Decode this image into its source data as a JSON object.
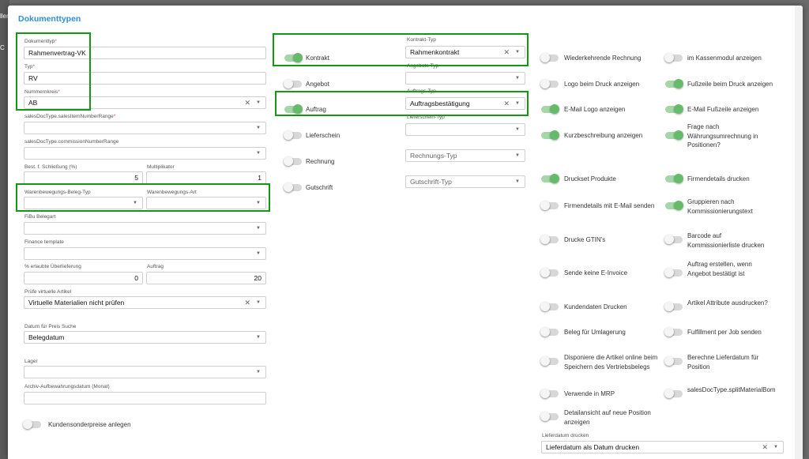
{
  "backdrop": {
    "frag_top": "llen",
    "frag_mid": "C"
  },
  "dialog": {
    "title": "Dokumenttypen"
  },
  "left": {
    "dokumenttyp": {
      "label": "Dokumenttyp",
      "value": "Rahmenvertrag-VK"
    },
    "typ": {
      "label": "Typ",
      "value": "RV"
    },
    "nummernkreis": {
      "label": "Nummernkreis",
      "value": "AB"
    },
    "item_number_range": {
      "label": "salesDocType.salesItemNumberRange",
      "value": ""
    },
    "commission_number_range": {
      "label": "salesDocType.commissionNumberRange",
      "value": ""
    },
    "schliessung": {
      "label": "Best. f. Schließung (%)",
      "value": "5"
    },
    "multiplikator": {
      "label": "Multiplikator",
      "value": "1"
    },
    "warenbewegungs_beleg_typ": {
      "label": "Warenbewegungs-Beleg-Typ",
      "value": ""
    },
    "warenbewegungs_art": {
      "label": "Warenbewegungs-Art",
      "value": ""
    },
    "fibu_belegart": {
      "label": "FiBu Belegart",
      "value": ""
    },
    "finance_template": {
      "label": "Finance template",
      "value": ""
    },
    "ueberlieferung": {
      "label": "% erlaubte Überlieferung",
      "value": "0"
    },
    "auftrag": {
      "label": "Auftrag",
      "value": "20"
    },
    "virtuelle_artikel": {
      "label": "Prüfe virtuelle Artikel",
      "value": "Virtuelle Materialien nicht prüfen"
    },
    "datum_preis_suche": {
      "label": "Datum für Preis Suche",
      "value": "Belegdatum"
    },
    "lager": {
      "label": "Lager",
      "value": ""
    },
    "archiv": {
      "label": "Archiv-Aufbewahrungsdatum (Monat)",
      "value": ""
    },
    "kundensonderpreise": {
      "label": "Kundensonderpreise anlegen",
      "on": false
    }
  },
  "middle": {
    "rows": [
      {
        "toggle": "Kontrakt",
        "on": true,
        "field_label": "Kontrakt-Typ",
        "value": "Rahmenkontrakt",
        "placeholder": ""
      },
      {
        "toggle": "Angebot",
        "on": false,
        "field_label": "Angebots-Typ",
        "value": "",
        "placeholder": ""
      },
      {
        "toggle": "Auftrag",
        "on": true,
        "field_label": "Auftrags-Typ",
        "value": "Auftragsbestätigung",
        "placeholder": ""
      },
      {
        "toggle": "Lieferschein",
        "on": false,
        "field_label": "Lieferschein-Typ",
        "value": "",
        "placeholder": ""
      },
      {
        "toggle": "Rechnung",
        "on": false,
        "field_label": "",
        "value": "",
        "placeholder": "Rechnungs-Typ"
      },
      {
        "toggle": "Gutschrift",
        "on": false,
        "field_label": "",
        "value": "",
        "placeholder": "Gutschrift-Typ"
      }
    ]
  },
  "right": {
    "col1": [
      {
        "label": "Wiederkehrende Rechnung",
        "on": false
      },
      {
        "label": "Logo beim Druck anzeigen",
        "on": false
      },
      {
        "label": "E-Mail Logo anzeigen",
        "on": true
      },
      {
        "label": "Kurzbeschreibung anzeigen",
        "on": true
      },
      {
        "label": "Druckset Produkte",
        "on": true
      },
      {
        "label": "Firmendetails mit E-Mail senden",
        "on": false
      },
      {
        "label": "Drucke GTIN's",
        "on": false
      },
      {
        "label": "Sende keine E-Invoice",
        "on": false
      },
      {
        "label": "Kundendaten Drucken",
        "on": false
      },
      {
        "label": "Beleg für Umlagerung",
        "on": false
      },
      {
        "label": "Disponiere die Artikel online beim Speichern des Vertriebsbelegs",
        "on": false
      },
      {
        "label": "Verwende in MRP",
        "on": false
      },
      {
        "label": "Detailansicht auf neue Position anzeigen",
        "on": false
      }
    ],
    "col2": [
      {
        "label": "im Kassenmodul anzeigen",
        "on": false
      },
      {
        "label": "Fußzeile beim Druck anzeigen",
        "on": true
      },
      {
        "label": "E-Mail Fußzeile anzeigen",
        "on": true
      },
      {
        "label": "Frage nach Währungsumrechnung in Positionen?",
        "on": true
      },
      {
        "label": "Firmendetails drucken",
        "on": true
      },
      {
        "label": "Gruppieren nach Kommissionierungstext",
        "on": true
      },
      {
        "label": "Barcode auf Kommissionierliste drucken",
        "on": false
      },
      {
        "label": "Auftrag erstellen, wenn Angebot bestätigt ist",
        "on": false
      },
      {
        "label": "Artikel Attribute ausdrucken?",
        "on": false
      },
      {
        "label": "Fulfillment per Job senden",
        "on": false
      },
      {
        "label": "Berechne Lieferdatum für Position",
        "on": false
      },
      {
        "label": "salesDocType.splitMaterialBom",
        "on": false
      }
    ],
    "lieferdatum": {
      "label": "Lieferdatum drucken",
      "value": "Lieferdatum als Datum drucken"
    }
  },
  "colors": {
    "accent": "#2e8fd6",
    "toggle_on": "#66bb6a",
    "highlight": "#119911",
    "required": "#d9534f"
  },
  "icons": {
    "clear": "close-icon",
    "dropdown": "chevron-down-icon"
  }
}
